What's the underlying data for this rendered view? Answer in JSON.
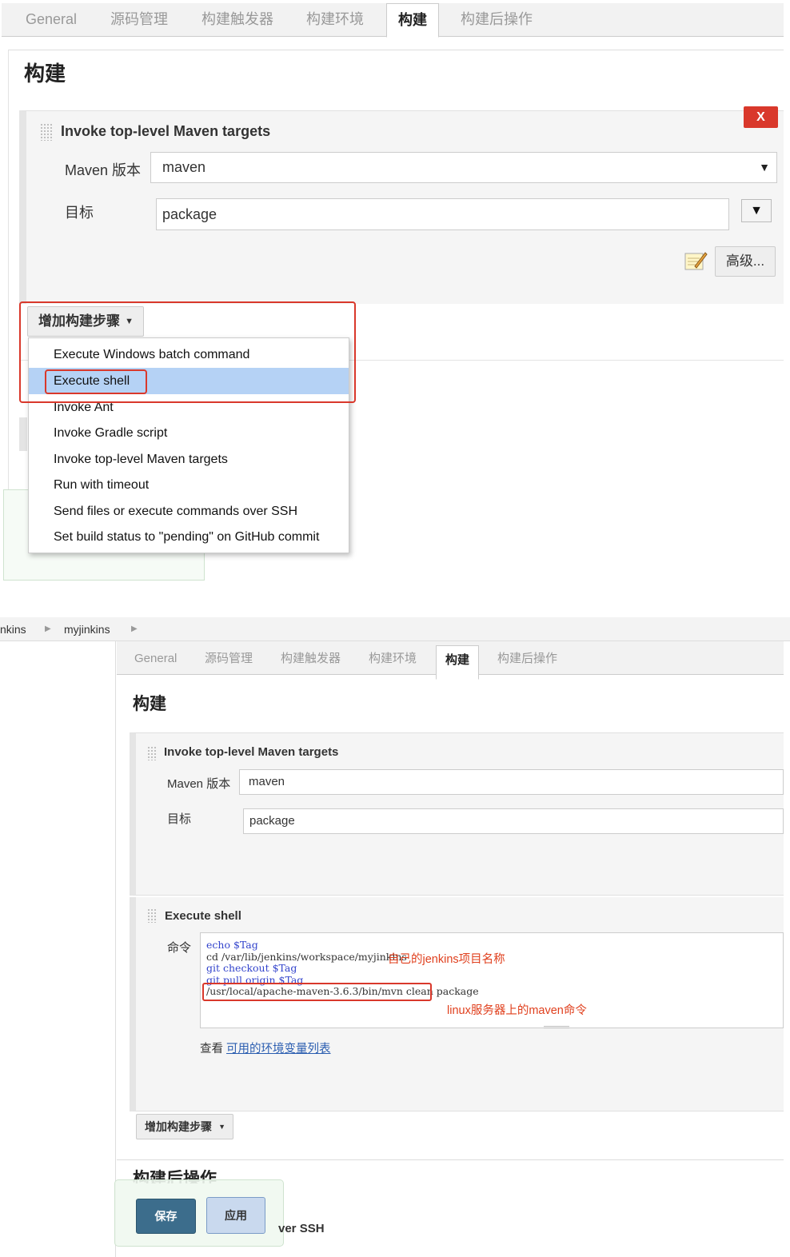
{
  "panel1": {
    "tabs": [
      "General",
      "源码管理",
      "构建触发器",
      "构建环境",
      "构建",
      "构建后操作"
    ],
    "active_tab": "构建",
    "section_title": "构建",
    "delete_label": "X",
    "step_title": "Invoke top-level Maven targets",
    "maven_version_label": "Maven 版本",
    "maven_version_value": "maven",
    "goals_label": "目标",
    "goals_value": "package",
    "advanced_label": "高级...",
    "add_step_label": "增加构建步骤",
    "menu_items": [
      "Execute Windows batch command",
      "Execute shell",
      "Invoke Ant",
      "Invoke Gradle script",
      "Invoke top-level Maven targets",
      "Run with timeout",
      "Send files or execute commands over SSH",
      "Set build status to \"pending\" on GitHub commit"
    ],
    "highlighted_item": "Execute shell"
  },
  "panel2": {
    "breadcrumb": [
      "nkins",
      "myjinkins"
    ],
    "tabs": [
      "General",
      "源码管理",
      "构建触发器",
      "构建环境",
      "构建",
      "构建后操作"
    ],
    "active_tab": "构建",
    "section_title": "构建",
    "step1_title": "Invoke top-level Maven targets",
    "maven_version_label": "Maven 版本",
    "maven_version_value": "maven",
    "goals_label": "目标",
    "goals_value": "package",
    "step2_title": "Execute shell",
    "command_label": "命令",
    "command_lines": [
      "echo $Tag",
      "cd /var/lib/jenkins/workspace/myjinkins",
      "git checkout $Tag",
      "git pull origin $Tag",
      "/usr/local/apache-maven-3.6.3/bin/mvn clean package"
    ],
    "annotation_project": "自己的jenkins项目名称",
    "annotation_maven": "linux服务器上的maven命令",
    "help_prefix": "查看",
    "help_link": "可用的环境变量列表",
    "add_step_label": "增加构建步骤",
    "post_build_title": "构建后操作",
    "save_label": "保存",
    "apply_label": "应用",
    "partial_text": "ver SSH"
  },
  "colors": {
    "highlight_box": "#d9382b",
    "menu_highlight": "#b5d2f5",
    "save_button": "#3c6d8c",
    "annotation": "#e0401e",
    "link": "#2a5db0"
  }
}
